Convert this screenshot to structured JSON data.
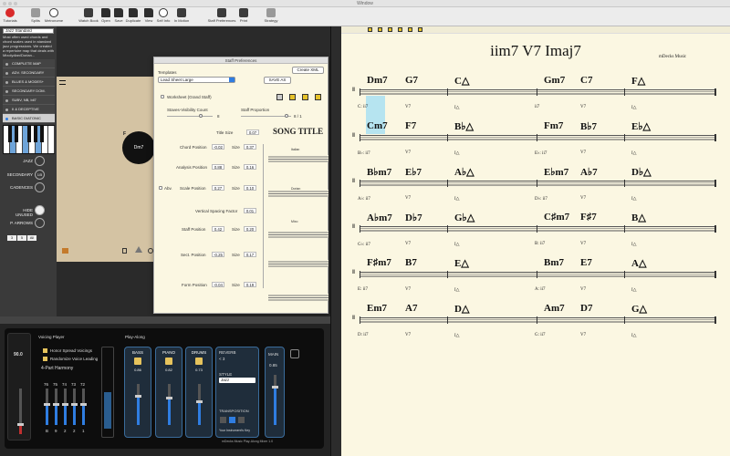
{
  "window": {
    "title": "Window"
  },
  "toolbar": {
    "left": [
      {
        "label": "Tutorials"
      },
      {
        "label": "Splits"
      },
      {
        "label": "Metronome"
      }
    ],
    "middle": [
      {
        "label": "Watch Book"
      },
      {
        "label": "Open"
      },
      {
        "label": "Save"
      },
      {
        "label": "Duplicate"
      },
      {
        "label": "View"
      },
      {
        "label": "Self Info"
      },
      {
        "label": "In Motion"
      }
    ],
    "right": [
      {
        "label": "Staff Preferences"
      },
      {
        "label": "Print"
      },
      {
        "label": "Strategy"
      }
    ]
  },
  "sidebar": {
    "category": "Jazz Standard",
    "description": "Most often used chords and chord scales used in standard jazz progressions. We created a repertoire map that deals with Mixolydian/Dorian...",
    "items": [
      {
        "label": "COMPLETE MAP"
      },
      {
        "label": "ADV. SECONDARY"
      },
      {
        "label": "BLUES & MODES+"
      },
      {
        "label": "SECONDARY DOM."
      },
      {
        "label": "SUBV, NB, bii7"
      },
      {
        "label": "II & DECEPTIVE"
      },
      {
        "label": "BASIC DIATONIC"
      }
    ],
    "jazz_label": "JAZZ",
    "secondary_label": "SECONDARY",
    "secondary_value": "1/5",
    "cadences_label": "CADENCES",
    "hide_unused_label": "HIDE UNUSED",
    "p_arrows_label": "P. ARROWS",
    "steps": [
      "3",
      "5",
      "All"
    ]
  },
  "circle": {
    "center_label": "Dm7",
    "f_label": "F"
  },
  "prefs": {
    "title": "Staff Preferences",
    "create_xml": "Create XML",
    "templates_label": "Templates",
    "template_value": "Lead Sheet Large",
    "save_as": "SAVE AS",
    "worksheet_label": "Worksheet (Grand Staff)",
    "staves_label": "Staves-Visibility Count",
    "staves_value": "8",
    "proportion_label": "Staff Proportion",
    "proportion_value": "8 / 1",
    "title_size_label": "Title Size",
    "title_size_value": "0.07",
    "song_title_preview": "SONG TITLE",
    "size_label": "Size",
    "chord_position_label": "Chord Position",
    "chord_position_value": "-0.02",
    "chord_size_value": "0.37",
    "analysis_position_label": "Analysis Position",
    "analysis_position_value": "0.88",
    "analysis_size_value": "0.16",
    "abv_label": "Abv.",
    "scale_position_label": "Scale Position",
    "scale_position_value": "0.27",
    "scale_size_value": "0.10",
    "vertical_spacing_label": "Vertical Spacing Factor",
    "vertical_spacing_value": "0.01",
    "staff_position_label": "Staff Position",
    "staff_position_value": "0.42",
    "staff_size_value": "0.20",
    "sect_position_label": "Sect. Position",
    "sect_position_value": "-0.25",
    "sect_size_value": "0.17",
    "form_position_label": "Form Position",
    "form_position_value": "-0.04",
    "form_size_value": "0.19",
    "preview_labels": [
      "Italian",
      "Dorian",
      "Mixo"
    ]
  },
  "mixer": {
    "voicing_player_label": "Voicing Player",
    "play_along_label": "Play-Along",
    "option1": "Honor Spread Voicings",
    "option2": "Randomize Voice Leading",
    "harmony_label": "4-Part Harmony",
    "tempo_value": "90.0",
    "voice_values": [
      "76",
      "75",
      "74",
      "73",
      "72"
    ],
    "voice_bottom": [
      "B",
      "9",
      "2",
      "2",
      "1"
    ],
    "bass_label": "BASS",
    "bass_value": "0.86",
    "piano_label": "PIANO",
    "piano_value": "0.82",
    "drums_label": "DRUMS",
    "drums_value": "0.73",
    "reverb_label": "REVERB",
    "reverb_value": "< 3",
    "style_label": "STYLE",
    "style_value": "Jazz",
    "transposition_label": "TRANSPOSITION",
    "instrument_key_label": "Your Instrument's Key",
    "main_label": "MAIN",
    "main_value": "0.85",
    "footer": "mDecks Music Play-Along Mixer 1.0"
  },
  "sheet": {
    "title": "iim7 V7 Imaj7",
    "composer": "mDecks Music",
    "rows": [
      {
        "chords": [
          "Dm7",
          "G7",
          "C△",
          "Gm7",
          "C7",
          "F△"
        ],
        "romans": [
          "C: ii7",
          "V7",
          "I△",
          "ii7",
          "V7",
          "I△"
        ]
      },
      {
        "chords": [
          "Cm7",
          "F7",
          "B♭△",
          "Fm7",
          "B♭7",
          "E♭△"
        ],
        "romans": [
          "B♭: ii7",
          "V7",
          "I△",
          "E♭: ii7",
          "V7",
          "I△"
        ]
      },
      {
        "chords": [
          "B♭m7",
          "E♭7",
          "A♭△",
          "E♭m7",
          "A♭7",
          "D♭△"
        ],
        "romans": [
          "A♭: ii7",
          "V7",
          "I△",
          "D♭: ii7",
          "V7",
          "I△"
        ]
      },
      {
        "chords": [
          "A♭m7",
          "D♭7",
          "G♭△",
          "C♯m7",
          "F♯7",
          "B△"
        ],
        "romans": [
          "G♭: ii7",
          "V7",
          "I△",
          "B: ii7",
          "V7",
          "I△"
        ]
      },
      {
        "chords": [
          "F♯m7",
          "B7",
          "E△",
          "Bm7",
          "E7",
          "A△"
        ],
        "romans": [
          "E: ii7",
          "V7",
          "I△",
          "A: ii7",
          "V7",
          "I△"
        ]
      },
      {
        "chords": [
          "Em7",
          "A7",
          "D△",
          "Am7",
          "D7",
          "G△"
        ],
        "romans": [
          "D: ii7",
          "V7",
          "I△",
          "G: ii7",
          "V7",
          "I△"
        ]
      }
    ]
  }
}
